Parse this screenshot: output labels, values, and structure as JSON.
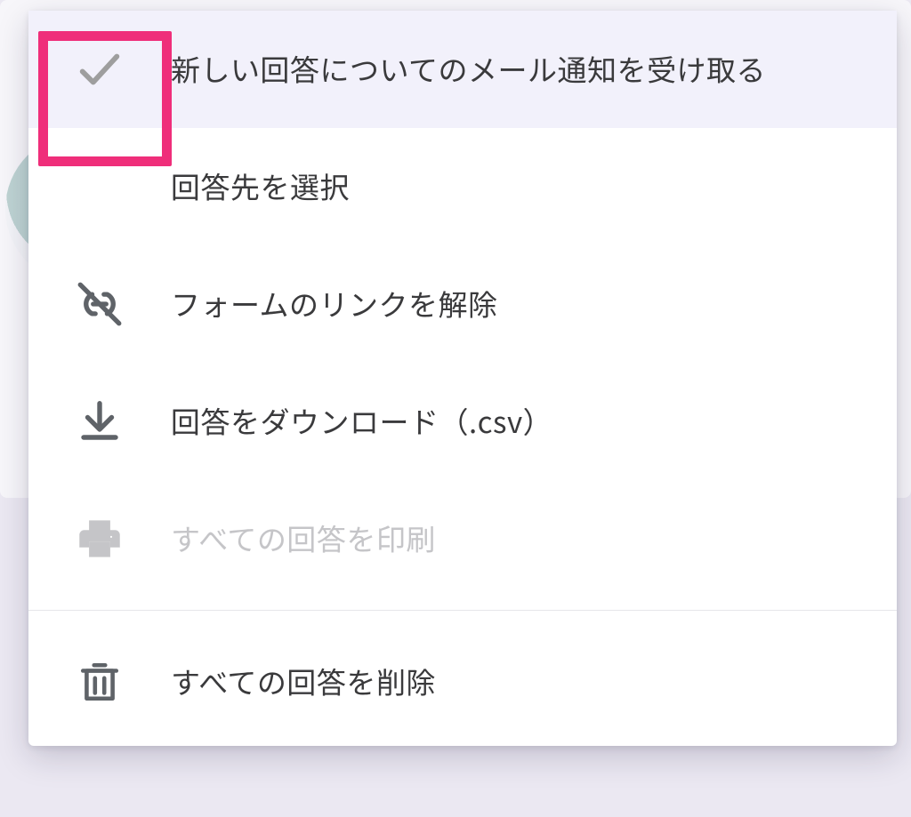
{
  "menu": {
    "items": [
      {
        "label": "新しい回答についてのメール通知を受け取る",
        "icon": "check",
        "selected": true,
        "disabled": false
      },
      {
        "label": "回答先を選択",
        "icon": "",
        "selected": false,
        "disabled": false
      },
      {
        "label": "フォームのリンクを解除",
        "icon": "unlink",
        "selected": false,
        "disabled": false
      },
      {
        "label": "回答をダウンロード（.csv）",
        "icon": "download",
        "selected": false,
        "disabled": false
      },
      {
        "label": "すべての回答を印刷",
        "icon": "print",
        "selected": false,
        "disabled": true
      },
      {
        "label": "すべての回答を削除",
        "icon": "trash",
        "selected": false,
        "disabled": false
      }
    ]
  }
}
